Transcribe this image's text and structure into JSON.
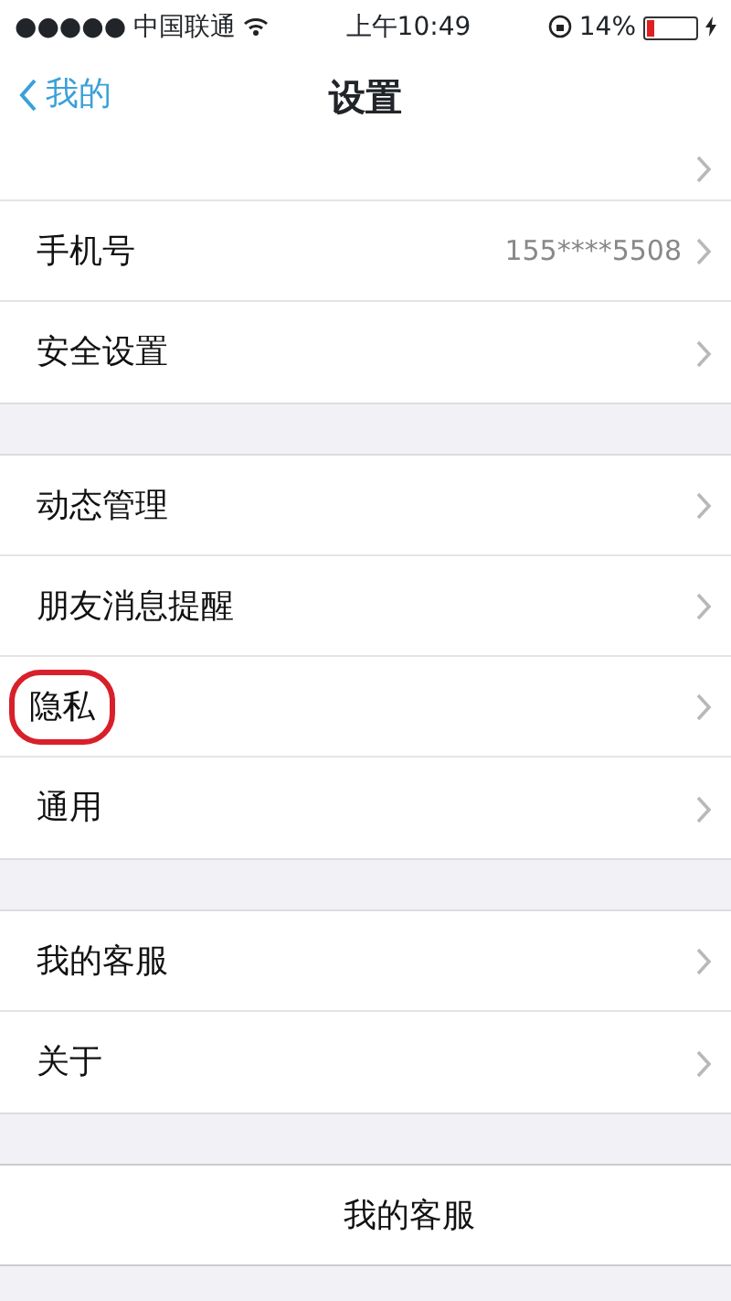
{
  "status_bar": {
    "signal_dots": "●●●●●",
    "carrier": "中国联通",
    "time": "上午10:49",
    "battery_percent": "14%",
    "battery": {
      "level": 0.14
    }
  },
  "nav": {
    "back_label": "我的",
    "title": "设置"
  },
  "groups": [
    {
      "cut_top": true,
      "rows": [
        {
          "label": "手机号",
          "value": "155****5508",
          "highlighted": false
        },
        {
          "label": "安全设置",
          "highlighted": false
        }
      ]
    },
    {
      "cut_top": false,
      "rows": [
        {
          "label": "动态管理",
          "highlighted": false
        },
        {
          "label": "朋友消息提醒",
          "highlighted": false
        },
        {
          "label": "隐私",
          "highlighted": true
        },
        {
          "label": "通用",
          "highlighted": false
        }
      ]
    },
    {
      "cut_top": false,
      "rows": [
        {
          "label": "我的客服",
          "highlighted": false
        },
        {
          "label": "关于",
          "highlighted": false
        }
      ]
    }
  ],
  "bottom_item": {
    "label": "我的客服"
  }
}
